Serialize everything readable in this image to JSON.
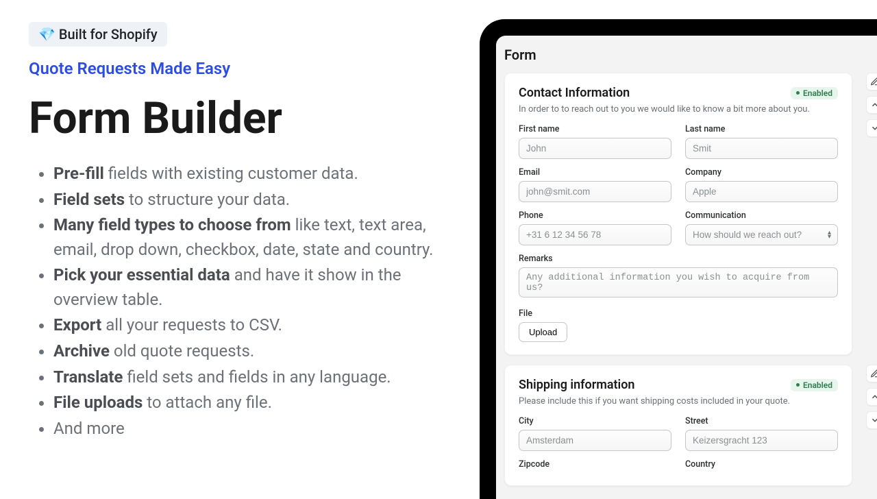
{
  "badge": "💎 Built for Shopify",
  "subtitle": "Quote Requests Made Easy",
  "title": "Form Builder",
  "features": [
    {
      "bold": "Pre-fill",
      "rest": " fields with existing customer data."
    },
    {
      "bold": "Field sets",
      "rest": " to structure your data."
    },
    {
      "bold": "Many field types to choose from",
      "rest": " like text, text area, email, drop down, checkbox, date, state and country."
    },
    {
      "bold": "Pick your essential data",
      "rest": " and have it show in the overview table."
    },
    {
      "bold": "Export",
      "rest": " all your requests to CSV."
    },
    {
      "bold": "Archive",
      "rest": " old quote requests."
    },
    {
      "bold": "Translate",
      "rest": " field sets and fields in any language."
    },
    {
      "bold": "File uploads",
      "rest": " to attach any file."
    },
    {
      "bold": "",
      "rest": "And more"
    }
  ],
  "form": {
    "title": "Form",
    "sections": {
      "contact": {
        "title": "Contact Information",
        "status": "Enabled",
        "desc": "In order to to reach out to you we would like to know a bit more about you.",
        "fields": {
          "first_name": {
            "label": "First name",
            "placeholder": "John"
          },
          "last_name": {
            "label": "Last name",
            "placeholder": "Smit"
          },
          "email": {
            "label": "Email",
            "placeholder": "john@smit.com"
          },
          "company": {
            "label": "Company",
            "placeholder": "Apple"
          },
          "phone": {
            "label": "Phone",
            "placeholder": "+31 6 12 34 56 78"
          },
          "communication": {
            "label": "Communication",
            "placeholder": "How should we reach out?"
          },
          "remarks": {
            "label": "Remarks",
            "placeholder": "Any additional information you wish to acquire from us?"
          },
          "file": {
            "label": "File",
            "button": "Upload"
          }
        }
      },
      "shipping": {
        "title": "Shipping information",
        "status": "Enabled",
        "desc": "Please include this if you want shipping costs included in your quote.",
        "fields": {
          "city": {
            "label": "City",
            "placeholder": "Amsterdam"
          },
          "street": {
            "label": "Street",
            "placeholder": "Keizersgracht 123"
          },
          "zipcode": {
            "label": "Zipcode"
          },
          "country": {
            "label": "Country"
          }
        }
      }
    }
  }
}
